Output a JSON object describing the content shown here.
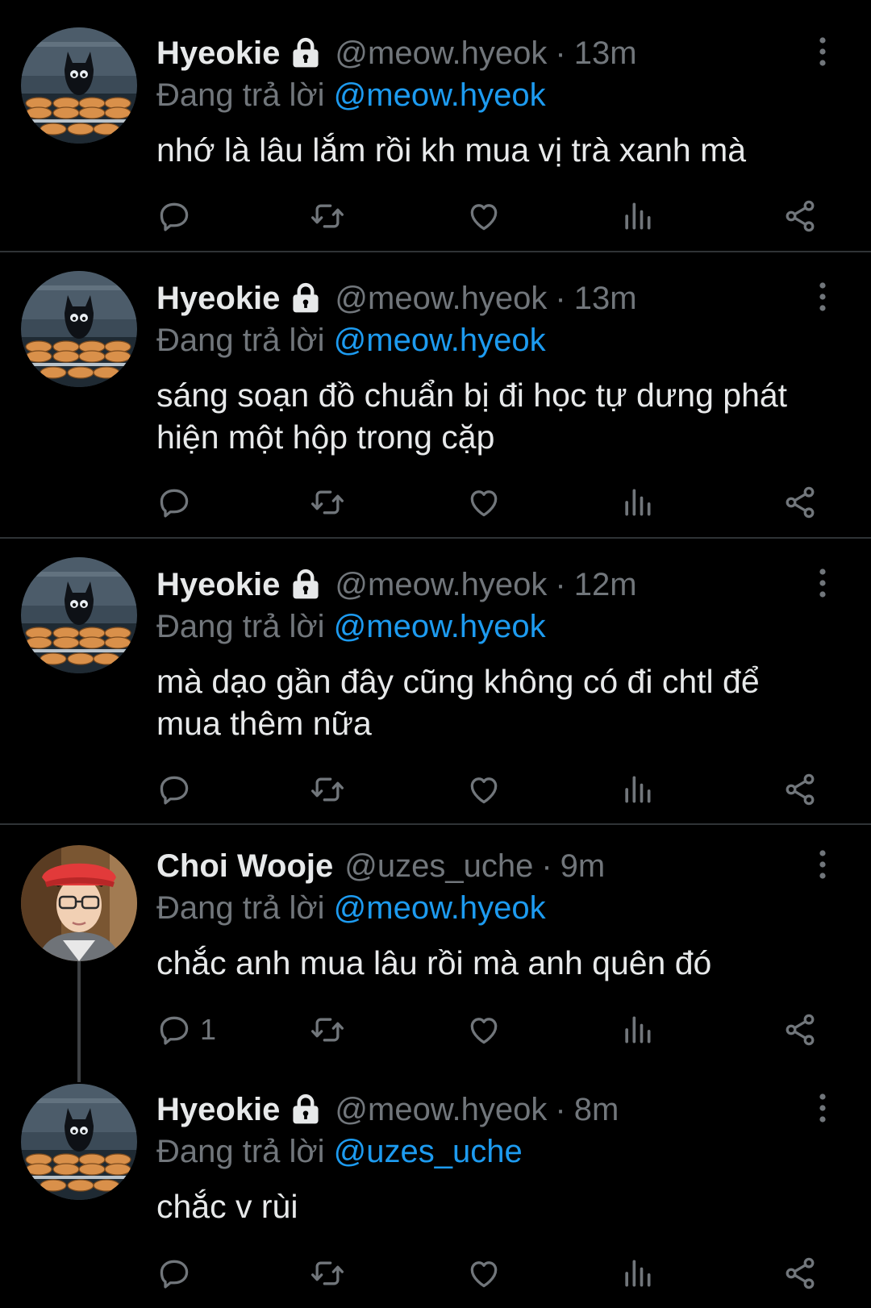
{
  "tweets": [
    {
      "name": "Hyeokie",
      "handle": "@meow.hyeok",
      "sep": "·",
      "time": "13m",
      "reply_prefix": "Đang trả lời",
      "reply_to": "@meow.hyeok",
      "text": "nhớ là lâu lắm rồi kh mua vị trà xanh mà",
      "reply_count": "",
      "avatar": "cat-avatar",
      "locked": true
    },
    {
      "name": "Hyeokie",
      "handle": "@meow.hyeok",
      "sep": "·",
      "time": "13m",
      "reply_prefix": "Đang trả lời",
      "reply_to": "@meow.hyeok",
      "text": "sáng soạn đồ chuẩn bị đi học tự dưng phát hiện một hộp trong cặp",
      "reply_count": "",
      "avatar": "cat-avatar",
      "locked": true
    },
    {
      "name": "Hyeokie",
      "handle": "@meow.hyeok",
      "sep": "·",
      "time": "12m",
      "reply_prefix": "Đang trả lời",
      "reply_to": "@meow.hyeok",
      "text": "mà dạo gần đây cũng không có đi chtl để mua thêm nữa",
      "reply_count": "",
      "avatar": "cat-avatar",
      "locked": true
    },
    {
      "name": "Choi Wooje",
      "handle": "@uzes_uche",
      "sep": "·",
      "time": "9m",
      "reply_prefix": "Đang trả lời",
      "reply_to": "@meow.hyeok",
      "text": "chắc anh mua lâu rồi mà anh quên đó",
      "reply_count": "1",
      "avatar": "person-avatar",
      "locked": false
    },
    {
      "name": "Hyeokie",
      "handle": "@meow.hyeok",
      "sep": "·",
      "time": "8m",
      "reply_prefix": "Đang trả lời",
      "reply_to": "@uzes_uche",
      "text": "chắc v rùi",
      "reply_count": "",
      "avatar": "cat-avatar",
      "locked": true
    }
  ],
  "icons": {
    "reply": "reply-icon",
    "retweet": "retweet-icon",
    "like": "heart-icon",
    "views": "views-icon",
    "share": "share-icon",
    "more": "more-vertical-icon",
    "lock": "lock-icon"
  },
  "colors": {
    "background": "#000000",
    "text": "#e7e9ea",
    "muted": "#71767b",
    "link": "#1d9bf0",
    "divider": "#2f3336"
  }
}
